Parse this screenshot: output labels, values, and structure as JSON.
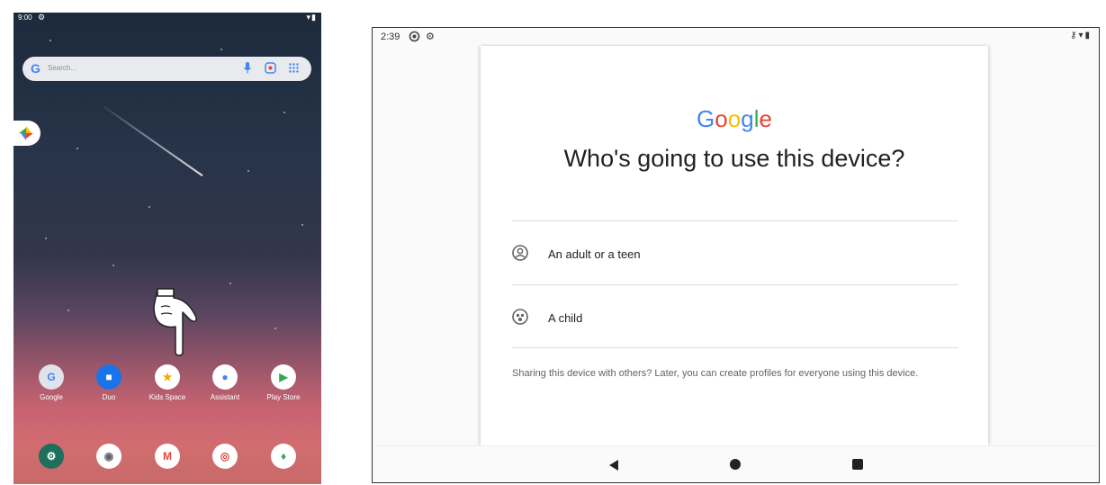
{
  "phone": {
    "status": {
      "time": "9:00"
    },
    "search": {
      "placeholder": "Search..."
    },
    "apps_row1": [
      {
        "label": "Google",
        "icon": "google-folder-icon",
        "color": "#dfe3ea"
      },
      {
        "label": "Duo",
        "icon": "duo-icon",
        "color": "#1a73e8"
      },
      {
        "label": "Kids Space",
        "icon": "kids-space-icon",
        "color": "#ffffff"
      },
      {
        "label": "Assistant",
        "icon": "assistant-icon",
        "color": "#ffffff"
      },
      {
        "label": "Play Store",
        "icon": "play-store-icon",
        "color": "#ffffff"
      }
    ],
    "apps_row2": [
      {
        "icon": "settings-icon",
        "color": "#1e6f5c"
      },
      {
        "icon": "camera-icon",
        "color": "#ffffff"
      },
      {
        "icon": "gmail-icon",
        "color": "#ffffff"
      },
      {
        "icon": "chrome-icon",
        "color": "#ffffff"
      },
      {
        "icon": "maps-icon",
        "color": "#ffffff"
      }
    ]
  },
  "tablet": {
    "status": {
      "time": "2:39"
    },
    "logo": "Google",
    "heading": "Who's going to use this device?",
    "options": [
      {
        "label": "An adult or a teen",
        "icon": "account-circle-icon"
      },
      {
        "label": "A child",
        "icon": "child-face-icon"
      }
    ],
    "footnote": "Sharing this device with others? Later, you can create profiles for everyone using this device."
  }
}
